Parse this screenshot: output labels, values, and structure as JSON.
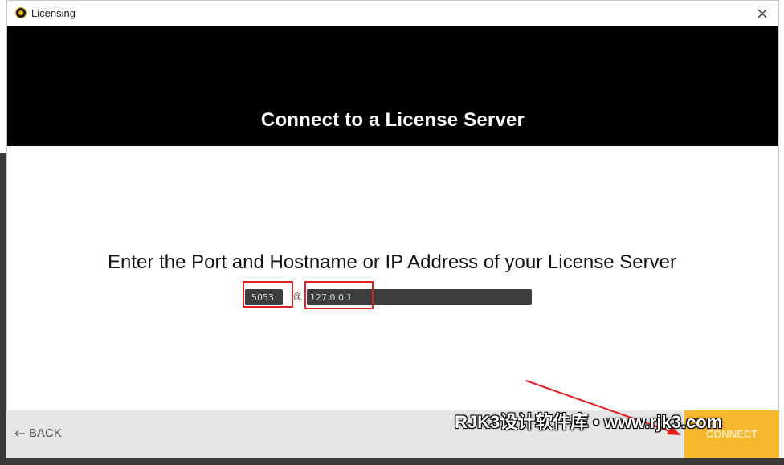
{
  "window": {
    "title": "Licensing",
    "close_icon": "close-icon"
  },
  "hero": {
    "title": "Connect to a License Server"
  },
  "form": {
    "prompt": "Enter the Port and Hostname or IP Address of your License Server",
    "port_value": "5053",
    "separator": "@",
    "host_value": "127.0.0.1"
  },
  "footer": {
    "back_label": "BACK",
    "connect_label": "CONNECT"
  },
  "overlay": {
    "caption": "RJK3设计软件库 • www.rjk3.com"
  },
  "colors": {
    "accent": "#f5b82e",
    "highlight": "#e02020",
    "hero_bg": "#000000",
    "input_bg": "#3d3d3d"
  }
}
